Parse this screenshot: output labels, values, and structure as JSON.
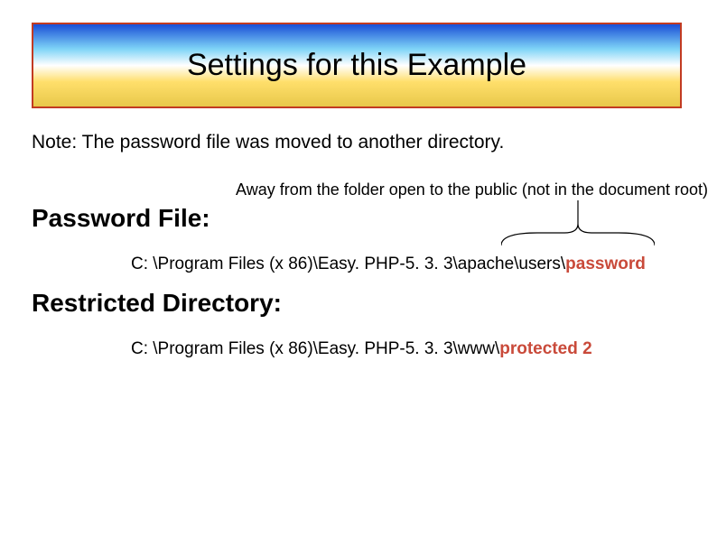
{
  "title": "Settings for this Example",
  "note": "Note: The password file was moved to another directory.",
  "away": "Away from the folder open to the public (not in the document root)",
  "sections": {
    "password_file": {
      "heading": "Password File:",
      "path_prefix": "C: \\Program Files (x 86)\\Easy. PHP-5. 3. 3\\apache\\users\\",
      "path_highlight": "password"
    },
    "restricted_dir": {
      "heading": "Restricted Directory:",
      "path_prefix": "C: \\Program Files (x 86)\\Easy. PHP-5. 3. 3\\www\\",
      "path_highlight": "protected 2"
    }
  }
}
